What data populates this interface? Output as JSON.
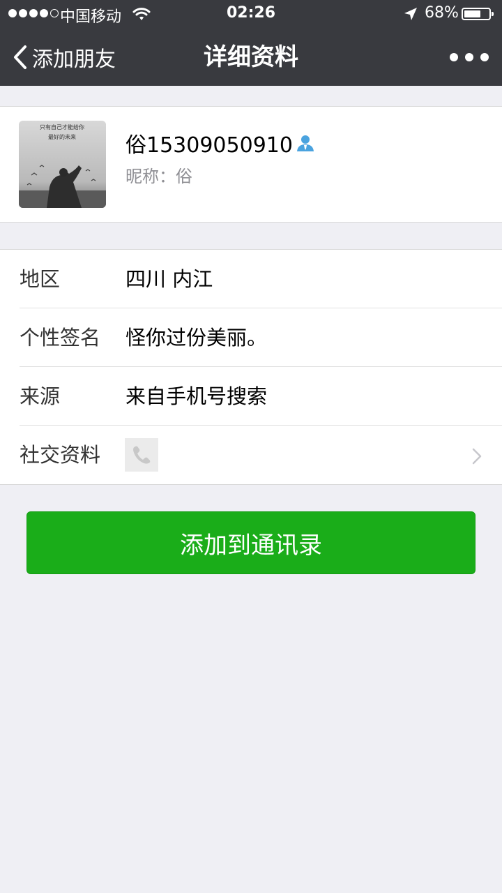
{
  "status_bar": {
    "carrier": "中国移动",
    "time": "02:26",
    "battery": "68%",
    "battery_level": 0.68
  },
  "nav": {
    "back_label": "添加朋友",
    "title": "详细资料"
  },
  "profile": {
    "name": "俗15309050910",
    "nickname": "昵称：俗",
    "avatar_caption_line1": "只有自己才能给你",
    "avatar_caption_line2": "最好的未来"
  },
  "info_rows": [
    {
      "label": "地区",
      "value": "四川  内江"
    },
    {
      "label": "个性签名",
      "value": "怪你过份美丽。"
    },
    {
      "label": "来源",
      "value": "来自手机号搜索"
    },
    {
      "label": "社交资料"
    }
  ],
  "actions": {
    "add_contact": "添加到通讯录"
  },
  "colors": {
    "nav_bg": "#393a3f",
    "page_bg": "#efeff4",
    "primary_button": "#1aad19",
    "contact_icon": "#4aa3df"
  },
  "icons": [
    "back-chevron-icon",
    "more-icon",
    "contact-person-icon",
    "phone-icon",
    "chevron-right-icon",
    "wifi-icon",
    "location-arrow-icon",
    "battery-icon"
  ]
}
